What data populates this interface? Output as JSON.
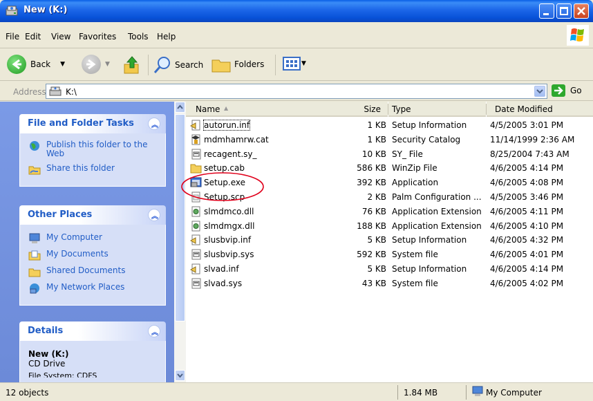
{
  "window": {
    "title": "New (K:)"
  },
  "menu": [
    "File",
    "Edit",
    "View",
    "Favorites",
    "Tools",
    "Help"
  ],
  "toolbar": {
    "back_label": "Back",
    "search_label": "Search",
    "folders_label": "Folders"
  },
  "address": {
    "label": "Address",
    "value": "K:\\",
    "go_label": "Go"
  },
  "taskpane": {
    "file_tasks": {
      "title": "File and Folder Tasks",
      "items": [
        "Publish this folder to the Web",
        "Share this folder"
      ]
    },
    "other_places": {
      "title": "Other Places",
      "items": [
        "My Computer",
        "My Documents",
        "Shared Documents",
        "My Network Places"
      ]
    },
    "details": {
      "title": "Details",
      "name": "New (K:)",
      "kind": "CD Drive",
      "fs_partial": "File System: CDFS"
    }
  },
  "columns": {
    "name": "Name",
    "size": "Size",
    "type": "Type",
    "date": "Date Modified"
  },
  "files": [
    {
      "name": "autorun.inf",
      "size": "1 KB",
      "type": "Setup Information",
      "date": "4/5/2005 3:01 PM",
      "icon": "inf-icon"
    },
    {
      "name": "mdmhamrw.cat",
      "size": "1 KB",
      "type": "Security Catalog",
      "date": "11/14/1999 2:36 AM",
      "icon": "catalog-icon"
    },
    {
      "name": "recagent.sy_",
      "size": "10 KB",
      "type": "SY_ File",
      "date": "8/25/2004 7:43 AM",
      "icon": "sys-file-icon"
    },
    {
      "name": "setup.cab",
      "size": "586 KB",
      "type": "WinZip File",
      "date": "4/6/2005 4:14 PM",
      "icon": "cab-icon"
    },
    {
      "name": "Setup.exe",
      "size": "392 KB",
      "type": "Application",
      "date": "4/6/2005 4:08 PM",
      "icon": "exe-icon"
    },
    {
      "name": "Setup.scp",
      "size": "2 KB",
      "type": "Palm Configuration ...",
      "date": "4/5/2005 3:46 PM",
      "icon": "scp-icon"
    },
    {
      "name": "slmdmco.dll",
      "size": "76 KB",
      "type": "Application Extension",
      "date": "4/6/2005 4:11 PM",
      "icon": "dll-icon"
    },
    {
      "name": "slmdmgx.dll",
      "size": "188 KB",
      "type": "Application Extension",
      "date": "4/6/2005 4:10 PM",
      "icon": "dll-icon"
    },
    {
      "name": "slusbvip.inf",
      "size": "5 KB",
      "type": "Setup Information",
      "date": "4/6/2005 4:32 PM",
      "icon": "inf-icon"
    },
    {
      "name": "slusbvip.sys",
      "size": "592 KB",
      "type": "System file",
      "date": "4/6/2005 4:01 PM",
      "icon": "sys-file-icon"
    },
    {
      "name": "slvad.inf",
      "size": "5 KB",
      "type": "Setup Information",
      "date": "4/6/2005 4:14 PM",
      "icon": "inf-icon"
    },
    {
      "name": "slvad.sys",
      "size": "43 KB",
      "type": "System file",
      "date": "4/6/2005 4:02 PM",
      "icon": "sys-file-icon"
    }
  ],
  "status": {
    "count": "12 objects",
    "size": "1.84 MB",
    "zone": "My Computer"
  },
  "colors": {
    "title_blue": "#0a5fe6",
    "task_link": "#215dc6",
    "annotation_red": "#e0001b"
  }
}
